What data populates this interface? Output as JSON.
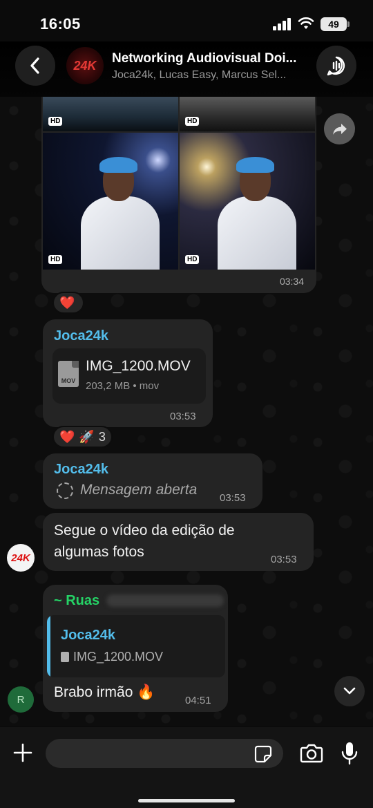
{
  "status_bar": {
    "time": "16:05",
    "battery": "49"
  },
  "header": {
    "title": "Networking Audiovisual Doi...",
    "members": "Joca24k, Lucas Easy, Marcus Sel...",
    "avatar_text": "24K",
    "icons": {
      "back": "chevron-left-icon",
      "call": "group-call-icon"
    }
  },
  "media_message": {
    "badge": "HD",
    "time": "03:34",
    "reactions": [
      "❤️"
    ]
  },
  "file_message": {
    "sender": "Joca24k",
    "file_icon_label": "MOV",
    "file_name": "IMG_1200.MOV",
    "file_meta": "203,2 MB • mov",
    "time": "03:53",
    "reactions": {
      "heart": "❤️",
      "rocket": "🚀",
      "count": "3"
    }
  },
  "opened_message": {
    "sender": "Joca24k",
    "text": "Mensagem aberta",
    "time": "03:53"
  },
  "text_message": {
    "line1": "Segue o vídeo da edição de",
    "line2": "algumas fotos",
    "time": "03:53",
    "avatar_text": "24K"
  },
  "reply_message": {
    "sender": "~ Ruas",
    "quoted_sender": "Joca24k",
    "quoted_file": "IMG_1200.MOV",
    "text": "Brabo irmão 🔥",
    "time": "04:51",
    "avatar_text": "R"
  },
  "input_bar": {
    "placeholder": ""
  }
}
